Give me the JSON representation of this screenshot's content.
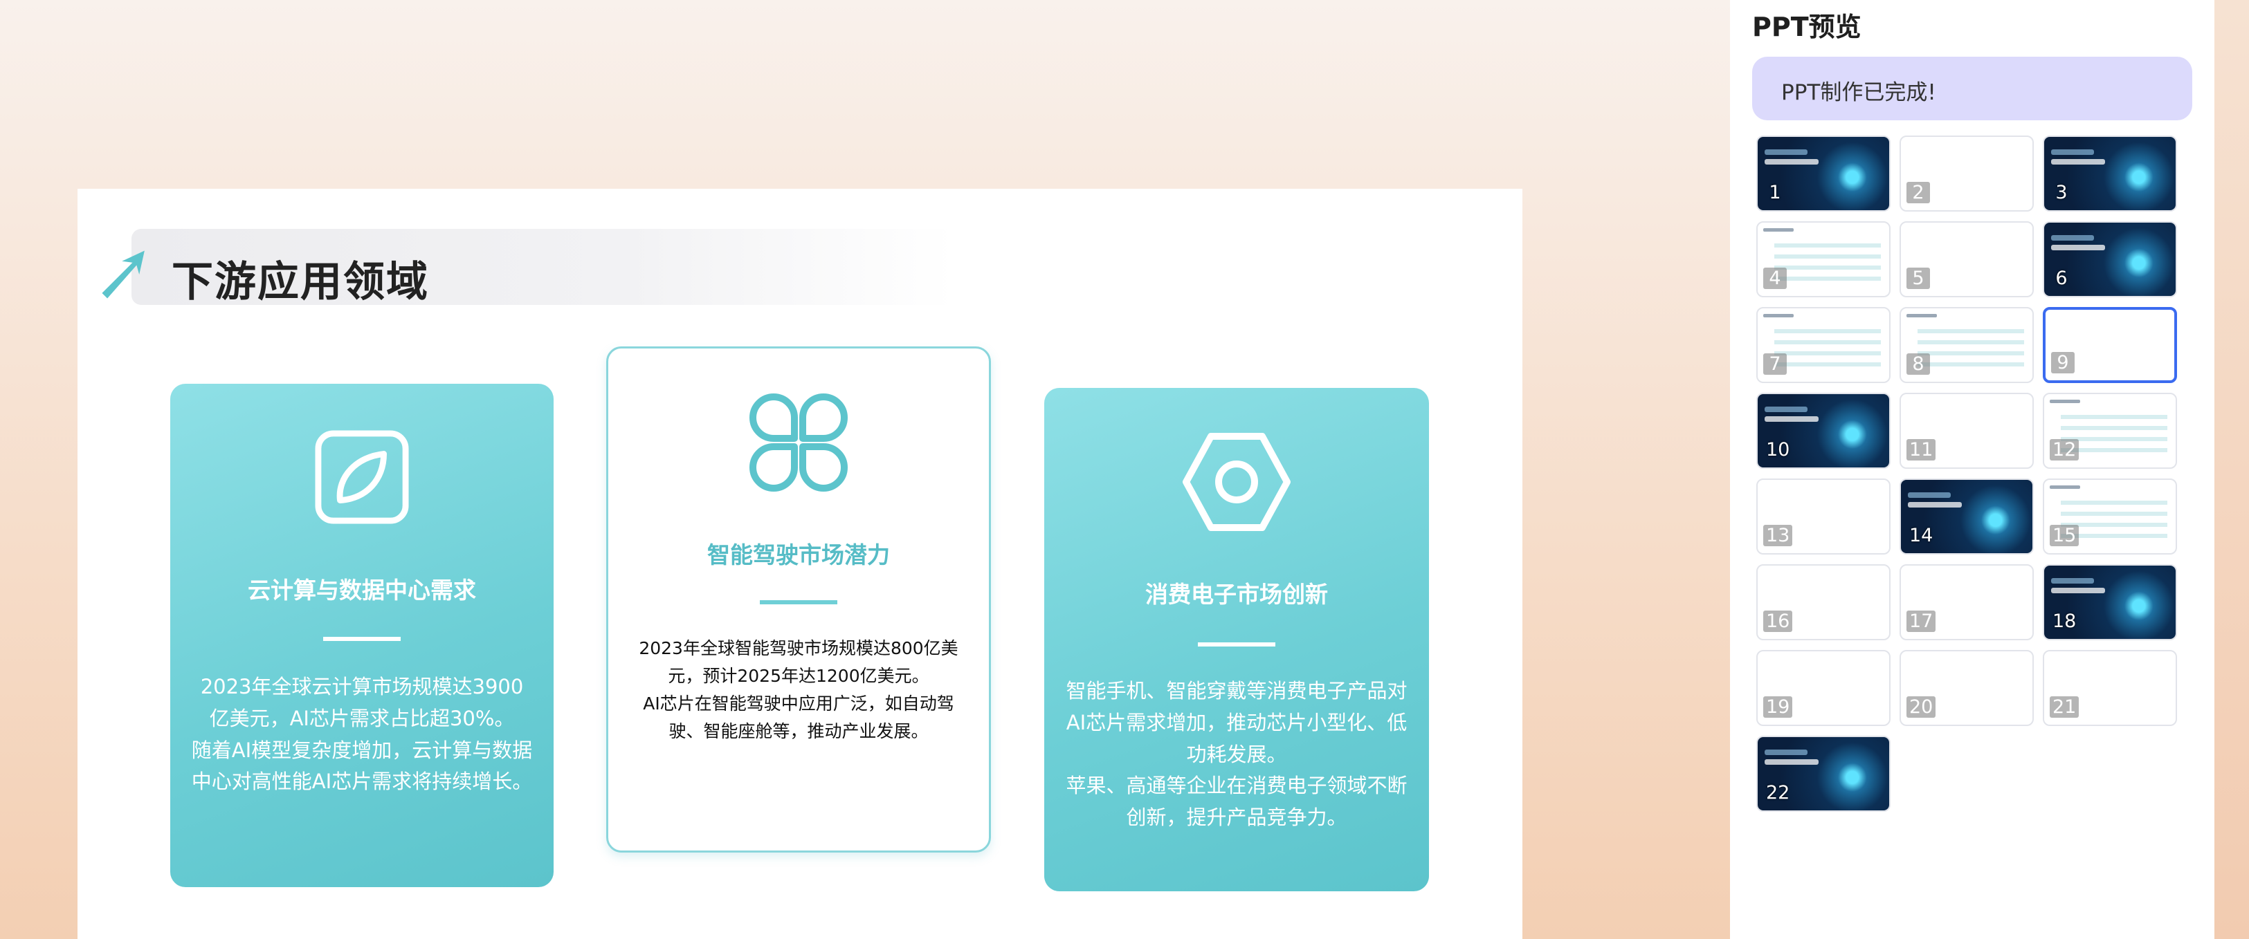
{
  "slide": {
    "title": "下游应用领域",
    "cards": [
      {
        "icon": "leaf-square-icon",
        "title": "云计算与数据中心需求",
        "body": [
          "2023年全球云计算市场规模达3900亿美元，AI芯片需求占比超30%。",
          "随着AI模型复杂度增加，云计算与数据中心对高性能AI芯片需求将持续增长。"
        ]
      },
      {
        "icon": "four-petal-icon",
        "title": "智能驾驶市场潜力",
        "body": [
          "2023年全球智能驾驶市场规模达800亿美元，预计2025年达1200亿美元。",
          "AI芯片在智能驾驶中应用广泛，如自动驾驶、智能座舱等，推动产业发展。"
        ]
      },
      {
        "icon": "hexagon-nut-icon",
        "title": "消费电子市场创新",
        "body": [
          "智能手机、智能穿戴等消费电子产品对AI芯片需求增加，推动芯片小型化、低功耗发展。",
          "苹果、高通等企业在消费电子领域不断创新，提升产品竞争力。"
        ]
      }
    ]
  },
  "panel": {
    "title": "PPT预览",
    "status": "PPT制作已完成!",
    "selected_slide": "9",
    "thumbnails": [
      {
        "num": "1",
        "style": "dark"
      },
      {
        "num": "2",
        "style": "accent"
      },
      {
        "num": "3",
        "style": "dark"
      },
      {
        "num": "4",
        "style": "light"
      },
      {
        "num": "5",
        "style": "accent"
      },
      {
        "num": "6",
        "style": "dark"
      },
      {
        "num": "7",
        "style": "light"
      },
      {
        "num": "8",
        "style": "light"
      },
      {
        "num": "9",
        "style": "accent"
      },
      {
        "num": "10",
        "style": "dark"
      },
      {
        "num": "11",
        "style": "accent"
      },
      {
        "num": "12",
        "style": "light"
      },
      {
        "num": "13",
        "style": "accent"
      },
      {
        "num": "14",
        "style": "dark"
      },
      {
        "num": "15",
        "style": "light"
      },
      {
        "num": "16",
        "style": "photo"
      },
      {
        "num": "17",
        "style": "photo"
      },
      {
        "num": "18",
        "style": "dark"
      },
      {
        "num": "19",
        "style": "accent"
      },
      {
        "num": "20",
        "style": "photo"
      },
      {
        "num": "21",
        "style": "photo"
      },
      {
        "num": "22",
        "style": "dark"
      }
    ]
  },
  "colors": {
    "accent_teal": "#6dcfd6",
    "selected_border": "#3b6bf0",
    "status_bg": "#dcdafc"
  }
}
